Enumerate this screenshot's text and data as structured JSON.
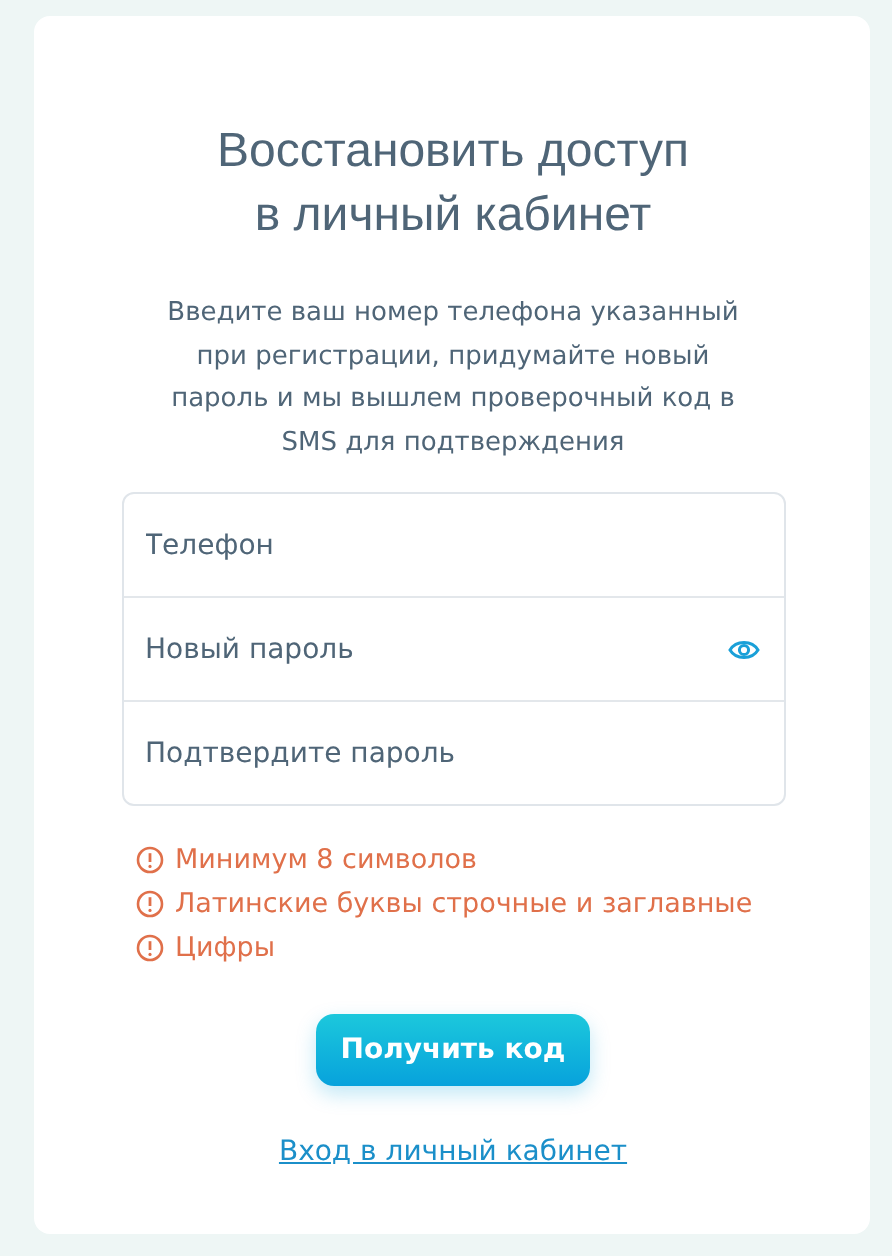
{
  "title": "Восстановить доступ в личный кабинет",
  "description": "Введите ваш номер телефона указанный при регистрации, придумайте новый пароль и мы вышлем проверочный код в SMS для подтверждения",
  "fields": [
    {
      "placeholder": "Телефон",
      "kind": "text"
    },
    {
      "placeholder": "Новый пароль",
      "kind": "password"
    },
    {
      "placeholder": "Подтвердите пароль",
      "kind": "plain-password"
    }
  ],
  "requirements": [
    "Минимум 8 символов",
    "Латинские буквы строчные и заглавные",
    "Цифры"
  ],
  "submit_button": "Получить код",
  "login_link": "Вход в личный кабинет"
}
